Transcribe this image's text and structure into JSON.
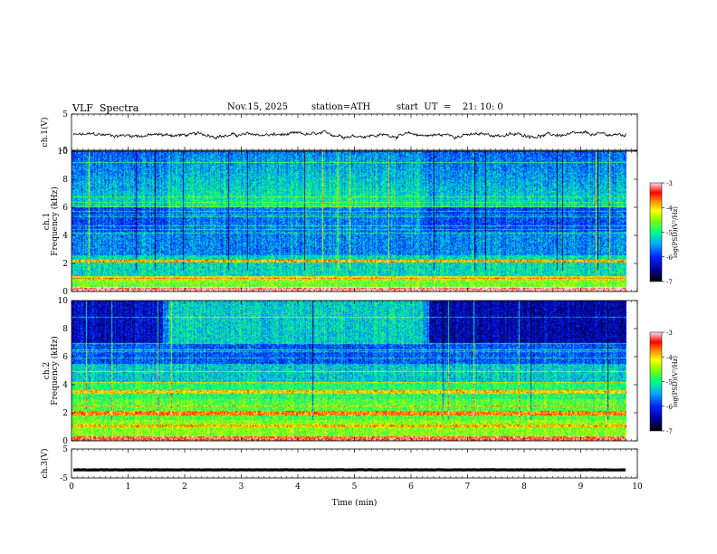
{
  "header": {
    "title": "VLF  Spectra",
    "date": "Nov.15, 2025",
    "station": "station=ATH",
    "start_ut": "start  UT  =    21: 10: 0"
  },
  "chart_data": [
    {
      "type": "line",
      "ylabel": "ch.1(V)",
      "ylim": [
        -5,
        5
      ],
      "yticks": [
        -5,
        5
      ],
      "description_values": {
        "mean_level": -0.8,
        "amplitude": 0.6
      }
    },
    {
      "type": "heatmap",
      "ylabel": "ch.1 Frequency (kHz)",
      "ylim": [
        0,
        10
      ],
      "yticks": [
        0,
        2,
        4,
        6,
        8,
        10
      ],
      "colorbar": {
        "label": "log(PSD)(V²/Hz)",
        "range": [
          -7,
          -3
        ],
        "ticks": [
          -7,
          -6,
          -5,
          -4,
          -3
        ]
      }
    },
    {
      "type": "heatmap",
      "ylabel": "ch.2 Frequency (kHz)",
      "ylim": [
        0,
        10
      ],
      "yticks": [
        0,
        2,
        4,
        6,
        8,
        10
      ],
      "colorbar": {
        "label": "log(PSD)(V²/Hz)",
        "range": [
          -7,
          -3
        ],
        "ticks": [
          -7,
          -6,
          -5,
          -4,
          -3
        ]
      }
    },
    {
      "type": "line",
      "ylabel": "ch.3(V)",
      "ylim": [
        -5,
        5
      ],
      "yticks": [
        -5,
        5
      ],
      "description_values": {
        "mean_level": -2.2,
        "amplitude": 0.1
      }
    }
  ],
  "xaxis": {
    "label": "Time  (min)",
    "range": [
      0,
      10
    ],
    "ticks": [
      0,
      1,
      2,
      3,
      4,
      5,
      6,
      7,
      8,
      9,
      10
    ],
    "data_end": 9.8
  },
  "colorbar_labels": {
    "unit": "log(PSD)(V²/Hz)",
    "ticks": [
      "-3",
      "-4",
      "-5",
      "-6",
      "-7"
    ]
  }
}
